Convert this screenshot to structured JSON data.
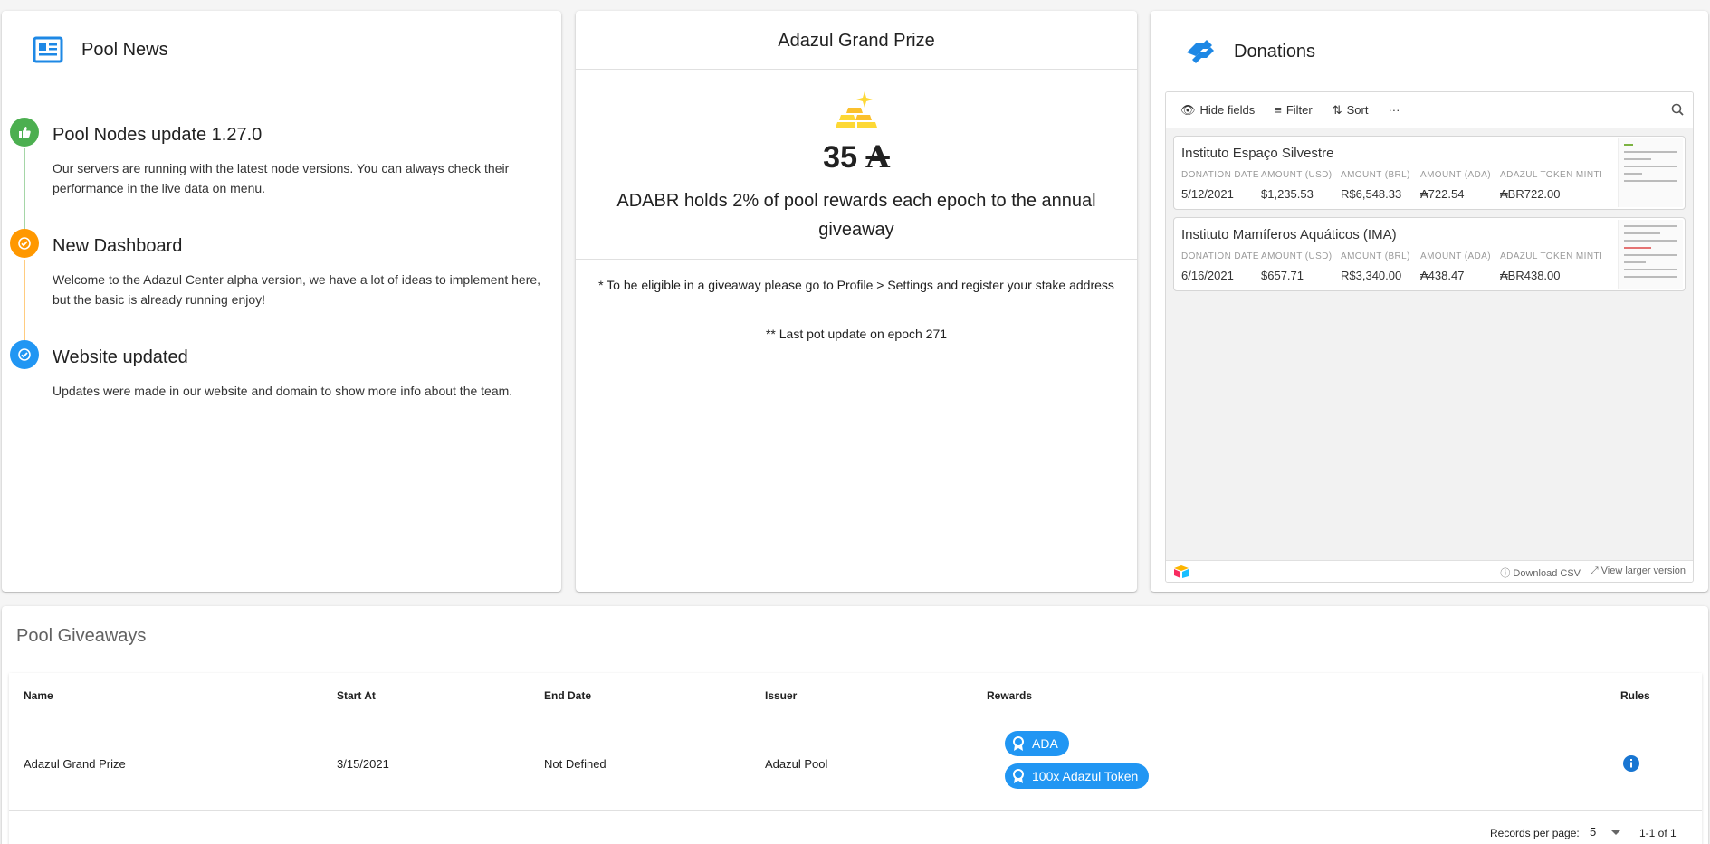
{
  "news": {
    "title": "Pool News",
    "items": [
      {
        "title": "Pool Nodes update 1.27.0",
        "text": "Our servers are running with the latest node versions. You can always check their performance in the live data on menu.",
        "color": "#4caf50",
        "icon": "thumbs-up-icon"
      },
      {
        "title": "New Dashboard",
        "text": "Welcome to the Adazul Center alpha version, we have a lot of ideas to implement here, but the basic is already running enjoy!",
        "color": "#ff9800",
        "icon": "check-circle-icon"
      },
      {
        "title": "Website updated",
        "text": "Updates were made in our website and domain to show more info about the team.",
        "color": "#2196f3",
        "icon": "check-circle-icon"
      }
    ]
  },
  "prize": {
    "title": "Adazul Grand Prize",
    "amount": "35",
    "currency_symbol": "A",
    "description": "ADABR holds 2% of pool rewards each epoch to the annual giveaway",
    "note": "* To be eligible in a giveaway please go to Profile > Settings and register your stake address",
    "note2": "** Last pot update on epoch 271"
  },
  "donations": {
    "title": "Donations",
    "toolbar": {
      "hide_fields": "Hide fields",
      "filter": "Filter",
      "sort": "Sort",
      "more": "···"
    },
    "columns": [
      "DONATION DATE",
      "AMOUNT (USD)",
      "AMOUNT (BRL)",
      "AMOUNT (ADA)",
      "ADAZUL TOKEN MINTI"
    ],
    "records": [
      {
        "name": "Instituto Espaço Silvestre",
        "values": [
          "5/12/2021",
          "$1,235.53",
          "R$6,548.33",
          "₳722.54",
          "₳BR722.00"
        ]
      },
      {
        "name": "Instituto Mamíferos Aquáticos (IMA)",
        "values": [
          "6/16/2021",
          "$657.71",
          "R$3,340.00",
          "₳438.47",
          "₳BR438.00"
        ]
      }
    ],
    "footer": {
      "download": "Download CSV",
      "view_larger": "View larger version"
    }
  },
  "giveaways": {
    "title": "Pool Giveaways",
    "headers": {
      "name": "Name",
      "start": "Start At",
      "end": "End Date",
      "issuer": "Issuer",
      "rewards": "Rewards",
      "rules": "Rules"
    },
    "rows": [
      {
        "name": "Adazul Grand Prize",
        "start": "3/15/2021",
        "end": "Not Defined",
        "issuer": "Adazul Pool",
        "rewards": [
          "ADA",
          "100x Adazul Token"
        ]
      }
    ],
    "footer": {
      "records_per_page_label": "Records per page:",
      "records_per_page": "5",
      "range": "1-1 of 1"
    }
  },
  "colors": {
    "primary": "#2196f3",
    "green": "#4caf50",
    "orange": "#ff9800",
    "gold": "#fdd835"
  }
}
